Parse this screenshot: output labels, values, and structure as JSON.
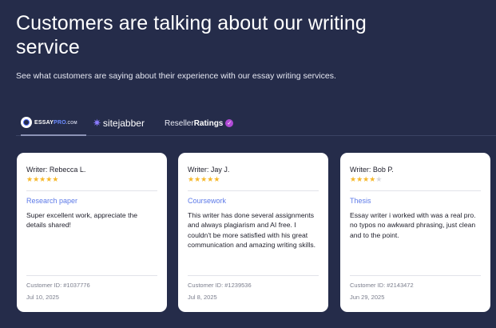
{
  "header": {
    "title": "Customers are talking about our writing service",
    "subtitle": "See what customers are saying about their experience with our essay writing services."
  },
  "tabs": {
    "essaypro": {
      "name": "ESSAY",
      "pro": "PRO",
      "com": ".COM"
    },
    "sitejabber": {
      "label": "sitejabber"
    },
    "reseller": {
      "label_normal": "Reseller",
      "label_bold": "Ratings"
    },
    "active": "essaypro"
  },
  "reviews": [
    {
      "writer": "Writer: Rebecca L.",
      "rating": 5,
      "category": "Research paper",
      "text": "Super excellent work, appreciate the details shared!",
      "customer_id": "Customer ID: #1037776",
      "date": "Jul 10, 2025"
    },
    {
      "writer": "Writer: Jay J.",
      "rating": 5,
      "category": "Coursework",
      "text": "This writer has done several assignments and always plagiarism and AI free. I couldn't be more satisfied with his great communication and amazing writing skills.",
      "customer_id": "Customer ID: #1239536",
      "date": "Jul 8, 2025"
    },
    {
      "writer": "Writer: Bob P.",
      "rating": 4,
      "category": "Thesis",
      "text": "Essay writer i worked with was a real pro. no typos no awkward phrasing, just clean and to the point.",
      "customer_id": "Customer ID: #2143472",
      "date": "Jun 29, 2025"
    }
  ],
  "colors": {
    "background": "#252c4a",
    "card": "#ffffff",
    "star": "#f6b82b",
    "category": "#5d7ae8"
  }
}
